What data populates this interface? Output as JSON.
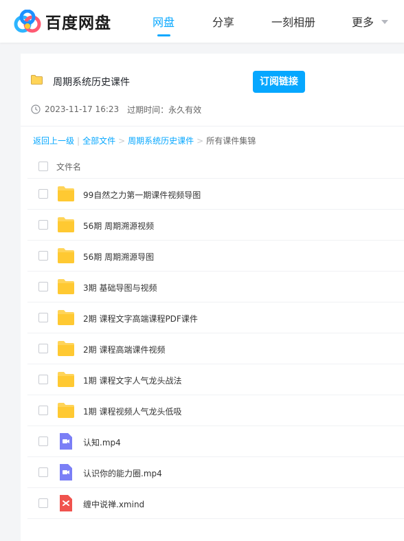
{
  "header": {
    "logo_text": "百度网盘",
    "nav": [
      {
        "label": "网盘",
        "active": true
      },
      {
        "label": "分享",
        "active": false
      },
      {
        "label": "一刻相册",
        "active": false
      },
      {
        "label": "更多",
        "active": false
      }
    ]
  },
  "share": {
    "title": "周期系统历史课件",
    "subscribe_label": "订阅链接",
    "date": "2023-11-17 16:23",
    "expire": "过期时间：永久有效"
  },
  "breadcrumb": {
    "back": "返回上一级",
    "divider": "|",
    "all_files": "全部文件",
    "folder": "周期系统历史课件",
    "current": "所有课件集锦",
    "sep": ">"
  },
  "list": {
    "header": "文件名",
    "files": [
      {
        "name": "99自然之力第一期课件视频导图",
        "type": "folder"
      },
      {
        "name": "56期 周期溯源视频",
        "type": "folder"
      },
      {
        "name": "56期 周期溯源导图",
        "type": "folder"
      },
      {
        "name": "3期 基础导图与视频",
        "type": "folder"
      },
      {
        "name": "2期 课程文字高端课程PDF课件",
        "type": "folder"
      },
      {
        "name": "2期 课程高端课件视频",
        "type": "folder"
      },
      {
        "name": "1期 课程文字人气龙头战法",
        "type": "folder"
      },
      {
        "name": "1期 课程视频人气龙头低吸",
        "type": "folder"
      },
      {
        "name": "认知.mp4",
        "type": "video"
      },
      {
        "name": "认识你的能力圈.mp4",
        "type": "video"
      },
      {
        "name": "缠中说禅.xmind",
        "type": "xmind"
      }
    ]
  },
  "colors": {
    "accent": "#06a7ff",
    "folder": "#ffd458",
    "video": "#7b7ff6",
    "xmind": "#f0534e"
  }
}
